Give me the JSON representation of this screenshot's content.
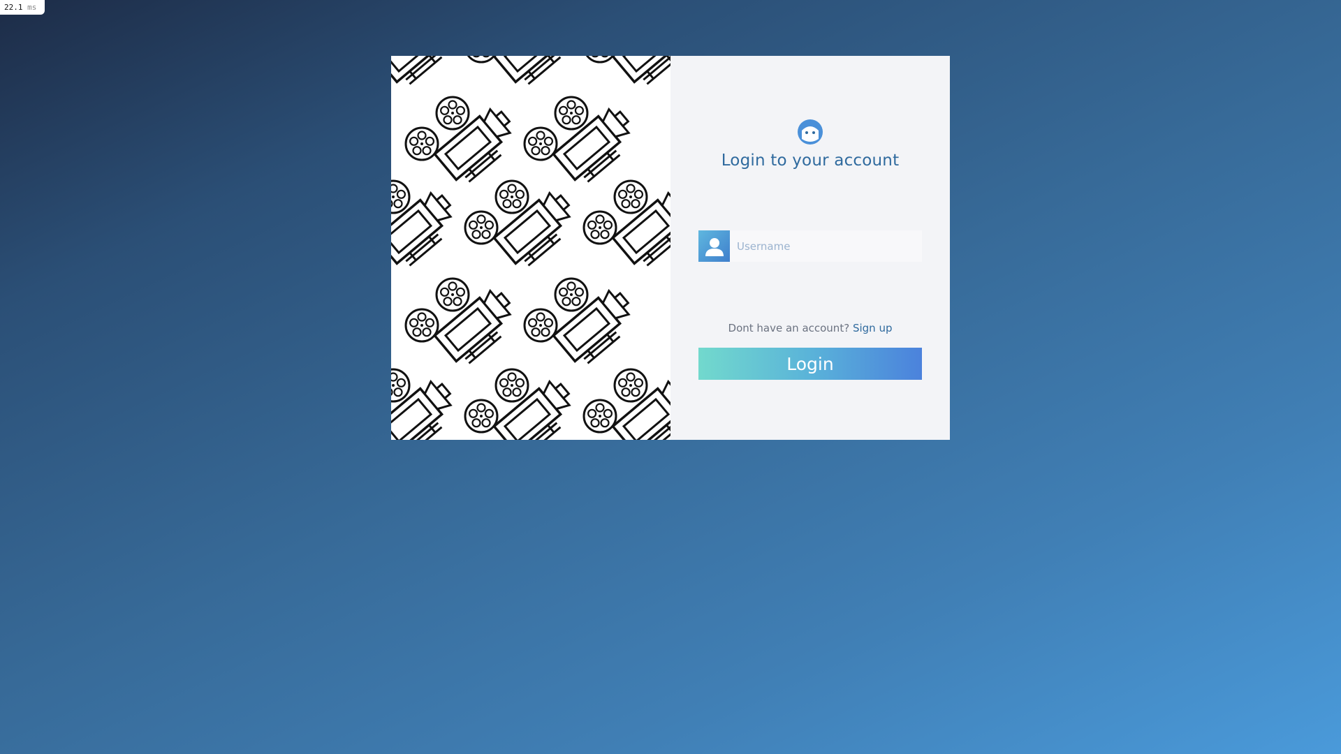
{
  "perf_overlay": {
    "value": "22.1",
    "unit": "ms"
  },
  "login_form": {
    "title": "Login to your account",
    "username_placeholder": "Username",
    "signup_prompt": "Dont have an account?",
    "signup_link": "Sign up",
    "login_button": "Login"
  },
  "icons": {
    "header": "face-icon",
    "username": "user-icon",
    "illustration": "film-projector-pattern"
  },
  "colors": {
    "title": "#2f6a9e",
    "link": "#2f6a9e",
    "button_gradient_start": "#72d9cd",
    "button_gradient_end": "#4b82dc",
    "form_background": "#f3f4f7"
  }
}
